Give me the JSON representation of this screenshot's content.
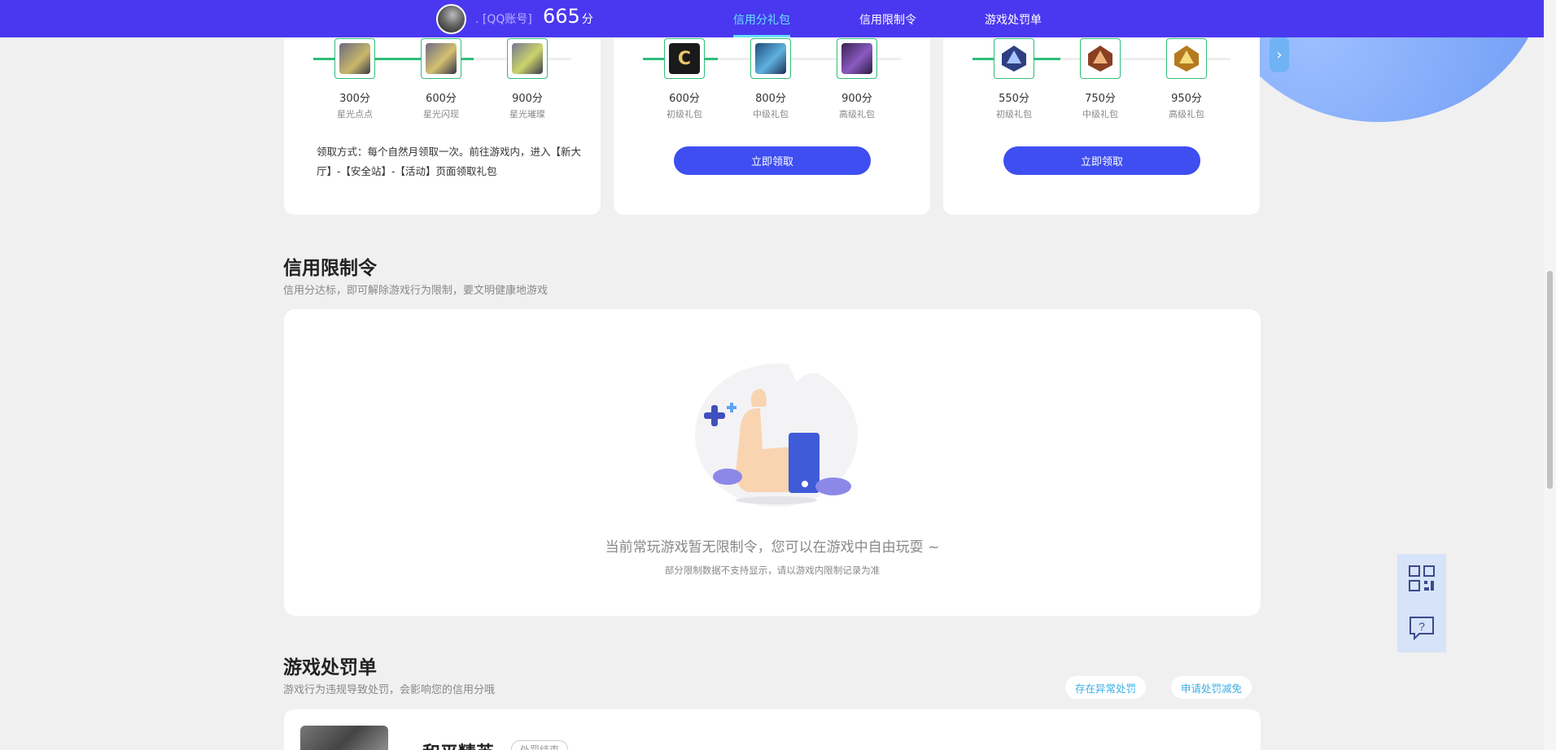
{
  "header": {
    "account_label": ". [QQ账号]",
    "score_value": "665",
    "score_unit": "分",
    "tabs": [
      {
        "label": "信用分礼包",
        "active": true
      },
      {
        "label": "信用限制令",
        "active": false
      },
      {
        "label": "游戏处罚单",
        "active": false
      }
    ]
  },
  "gift_cards": [
    {
      "progress": 0.62,
      "gifts": [
        {
          "score": "300分",
          "name": "星光点点",
          "icon": "star-light-gun-icon"
        },
        {
          "score": "600分",
          "name": "星光闪现",
          "icon": "star-flash-gun-icon"
        },
        {
          "score": "900分",
          "name": "星光璀璨",
          "icon": "star-brilliant-gun-icon"
        }
      ],
      "note": "领取方式：每个自然月领取一次。前往游戏内，进入【新大厅】-【安全站】-【活动】页面领取礼包"
    },
    {
      "progress": 0.29,
      "gifts": [
        {
          "score": "600分",
          "name": "初级礼包",
          "icon": "c-badge-icon"
        },
        {
          "score": "800分",
          "name": "中级礼包",
          "icon": "rifle-card-icon"
        },
        {
          "score": "900分",
          "name": "高级礼包",
          "icon": "purple-vehicle-icon"
        }
      ],
      "button": "立即领取"
    },
    {
      "progress": 0.34,
      "gifts": [
        {
          "score": "550分",
          "name": "初级礼包",
          "icon": "blue-rank-badge-icon"
        },
        {
          "score": "750分",
          "name": "中级礼包",
          "icon": "bronze-rank-badge-icon"
        },
        {
          "score": "950分",
          "name": "高级礼包",
          "icon": "gold-rank-badge-icon"
        }
      ],
      "button": "立即领取"
    }
  ],
  "restriction": {
    "title": "信用限制令",
    "subtitle": "信用分达标，即可解除游戏行为限制，要文明健康地游戏",
    "empty_text": "当前常玩游戏暂无限制令，您可以在游戏中自由玩耍 ~",
    "empty_sub": "部分限制数据不支持显示，请以游戏内限制记录为准",
    "illustration": "thumbs-up-illustration"
  },
  "penalty": {
    "title": "游戏处罚单",
    "subtitle": "游戏行为违规导致处罚，会影响您的信用分哦",
    "btn_abnormal": "存在异常处罚",
    "btn_reduce": "申请处罚减免",
    "record_title": "和平精英",
    "record_badge": "处罚结束"
  },
  "side_tools": [
    {
      "icon": "qr-code-icon"
    },
    {
      "icon": "help-chat-icon"
    }
  ],
  "colors": {
    "nav_bg": "#4a38f0",
    "accent_green": "#2dbd7a",
    "button_blue": "#3e4ef0",
    "active_tab": "#67e0ff"
  }
}
